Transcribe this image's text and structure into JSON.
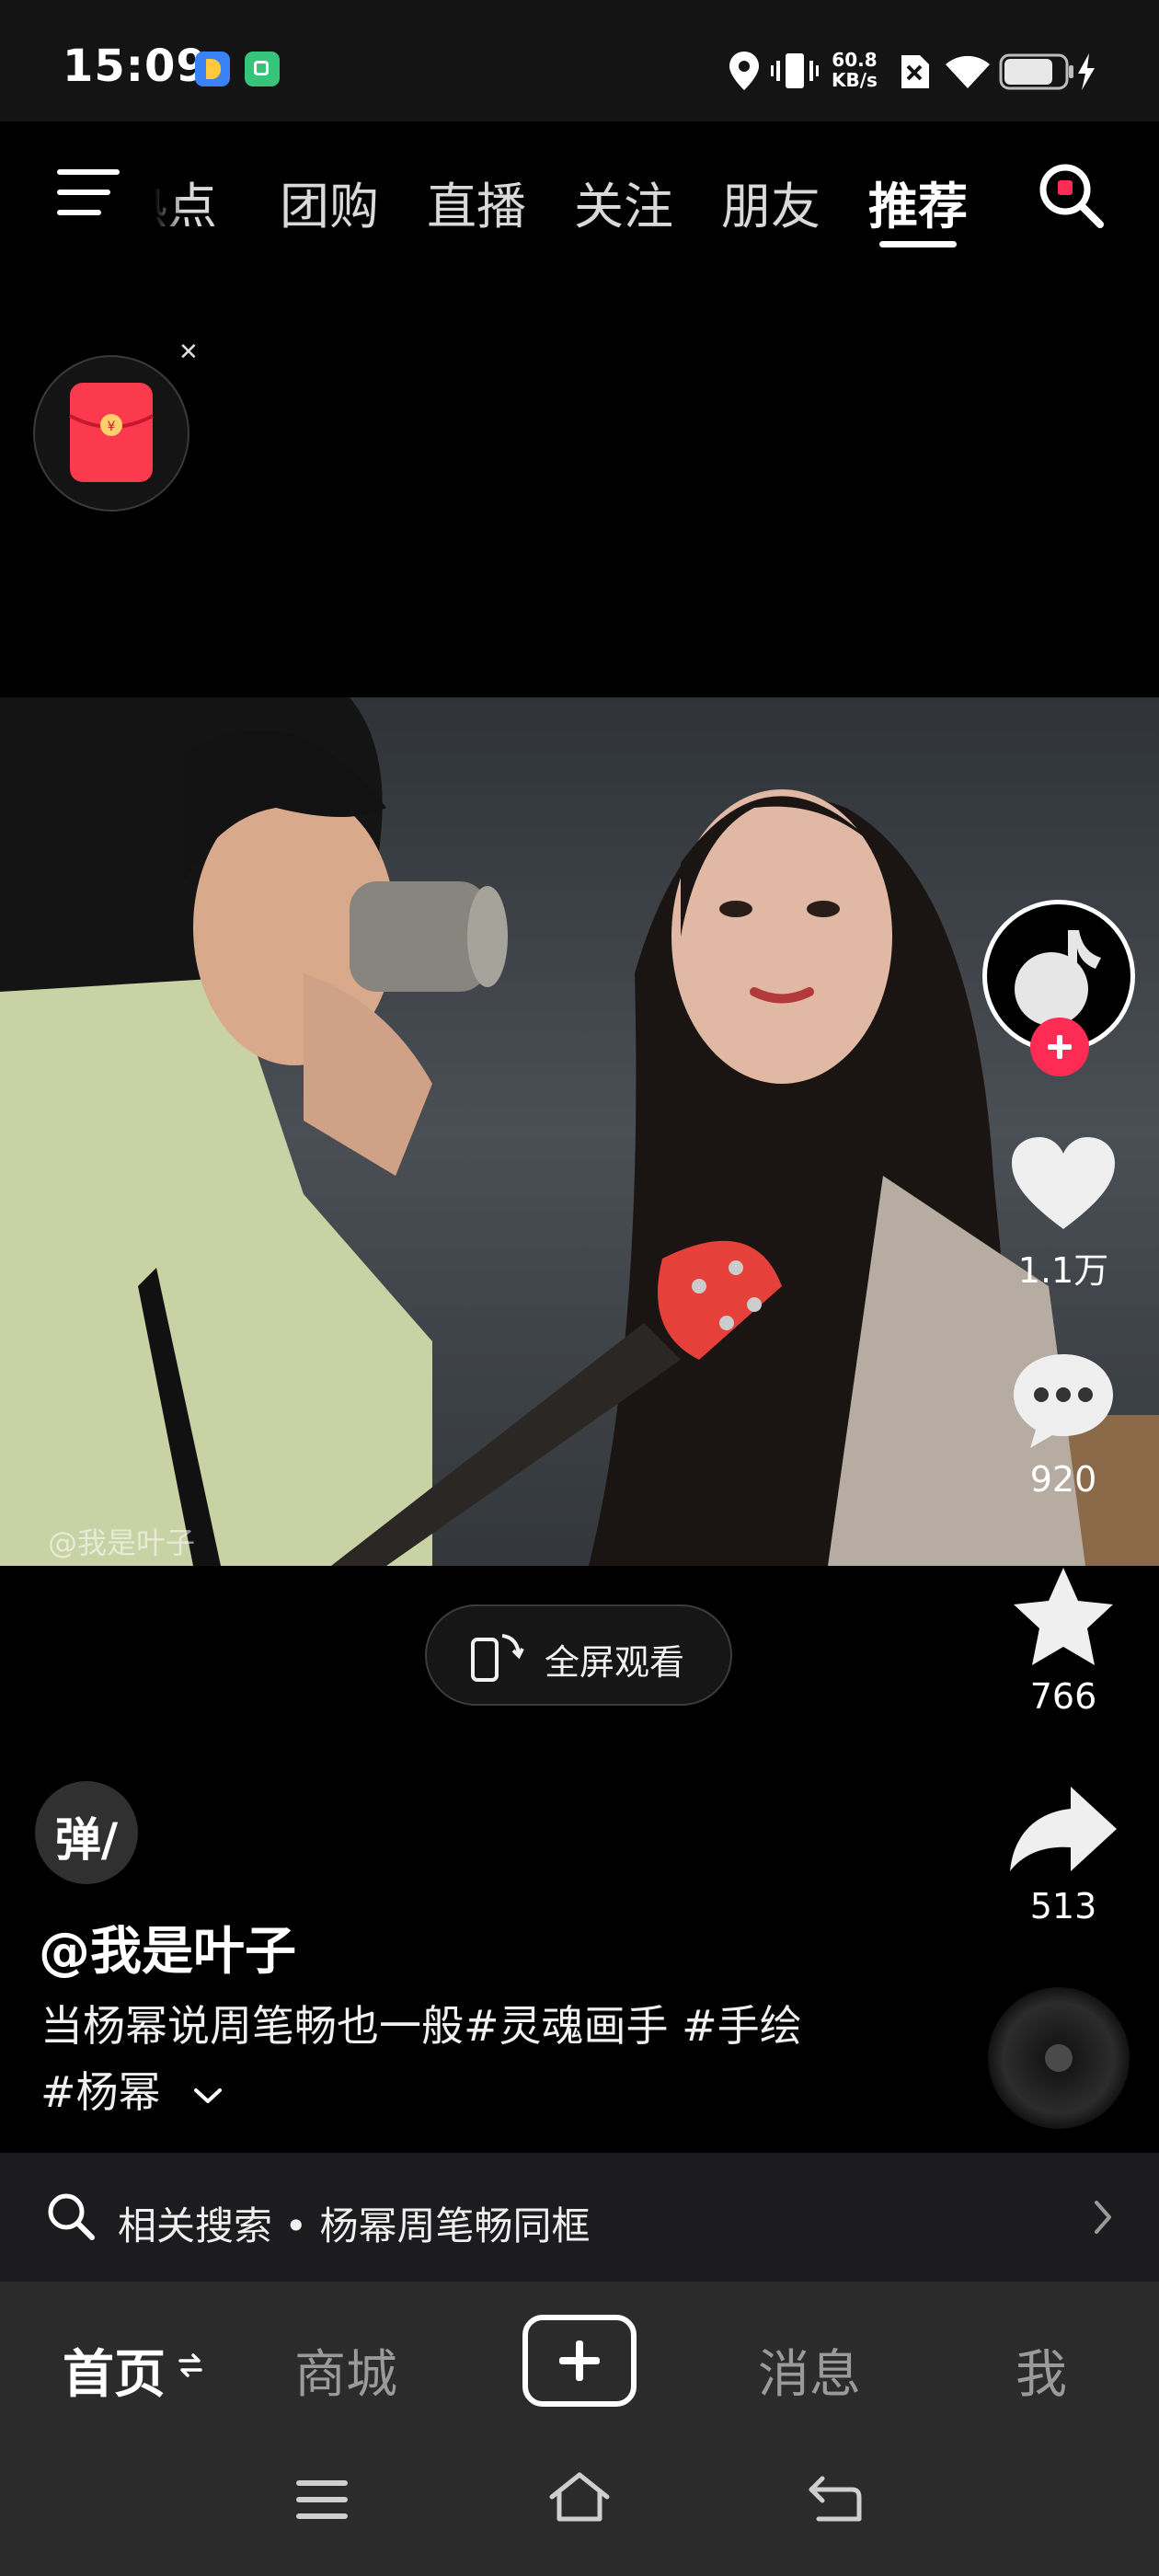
{
  "status_bar": {
    "time": "15:09",
    "net_speed_value": "60.8",
    "net_speed_unit": "KB/s",
    "icons": [
      "app-blue-icon",
      "app-green-icon",
      "location-icon",
      "vibrate-icon",
      "no-sim-icon",
      "wifi-icon",
      "battery-icon",
      "charging-icon"
    ]
  },
  "top_nav": {
    "tabs": [
      "热点",
      "团购",
      "直播",
      "关注",
      "朋友",
      "推荐"
    ],
    "active_tab": "推荐"
  },
  "video": {
    "watermark": "@我是叶子"
  },
  "fullscreen_button": {
    "label": "全屏观看"
  },
  "actions": {
    "likes": "1.1万",
    "comments": "920",
    "favorites": "766",
    "shares": "513"
  },
  "caption": {
    "danmu_label": "弹",
    "author": "@我是叶子",
    "description": "当杨幂说周笔畅也一般#灵魂画手 #手绘 #杨幂"
  },
  "related_search": {
    "text": "相关搜索 • 杨幂周笔畅同框"
  },
  "bottom_nav": {
    "tabs": [
      "首页",
      "商城",
      "消息",
      "我"
    ],
    "active": "首页"
  },
  "colors": {
    "accent_red": "#fe2c55",
    "background": "#000000",
    "bottom_bar": "#2b2b2b"
  }
}
